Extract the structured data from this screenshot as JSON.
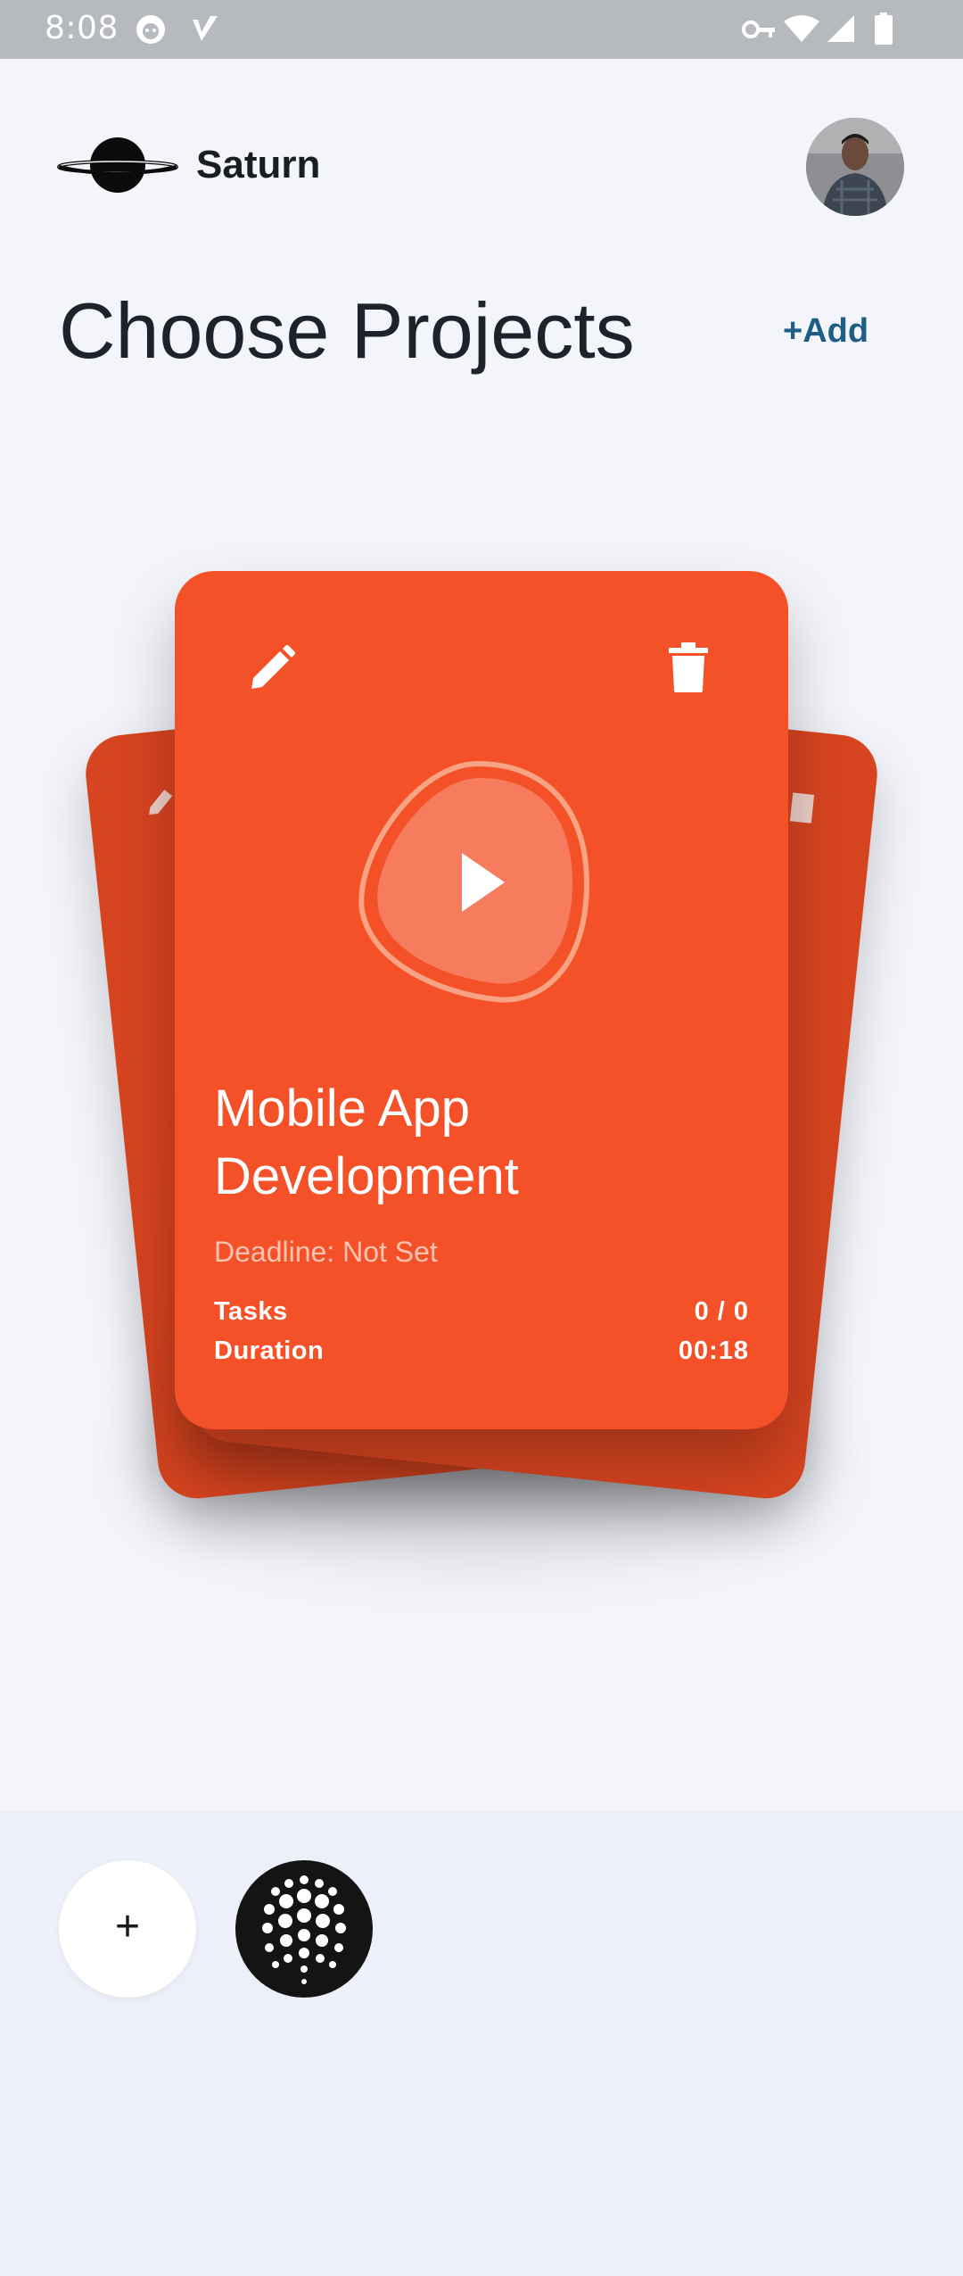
{
  "status_bar": {
    "time": "8:08",
    "icons": [
      "cat-icon",
      "v-icon",
      "vpn-key-icon",
      "wifi-icon",
      "signal-icon",
      "battery-icon"
    ]
  },
  "header": {
    "app_name": "Saturn",
    "logo_icon": "saturn-planet-icon",
    "avatar_icon": "user-avatar"
  },
  "page": {
    "title": "Choose Projects",
    "add_label": "+Add"
  },
  "project_card": {
    "title": "Mobile App Development",
    "deadline": "Deadline: Not Set",
    "stats": [
      {
        "label": "Tasks",
        "value": "0 / 0"
      },
      {
        "label": "Duration",
        "value": "00:18"
      }
    ],
    "edit_icon": "pencil-icon",
    "delete_icon": "trash-icon",
    "play_icon": "play-icon"
  },
  "bottom_bar": {
    "add_symbol": "+",
    "project_icon": "dotted-sphere-icon"
  },
  "colors": {
    "card": "#f45128",
    "card_back": "#d74420",
    "accent": "#1e5e85",
    "background": "#f3f5fb"
  }
}
